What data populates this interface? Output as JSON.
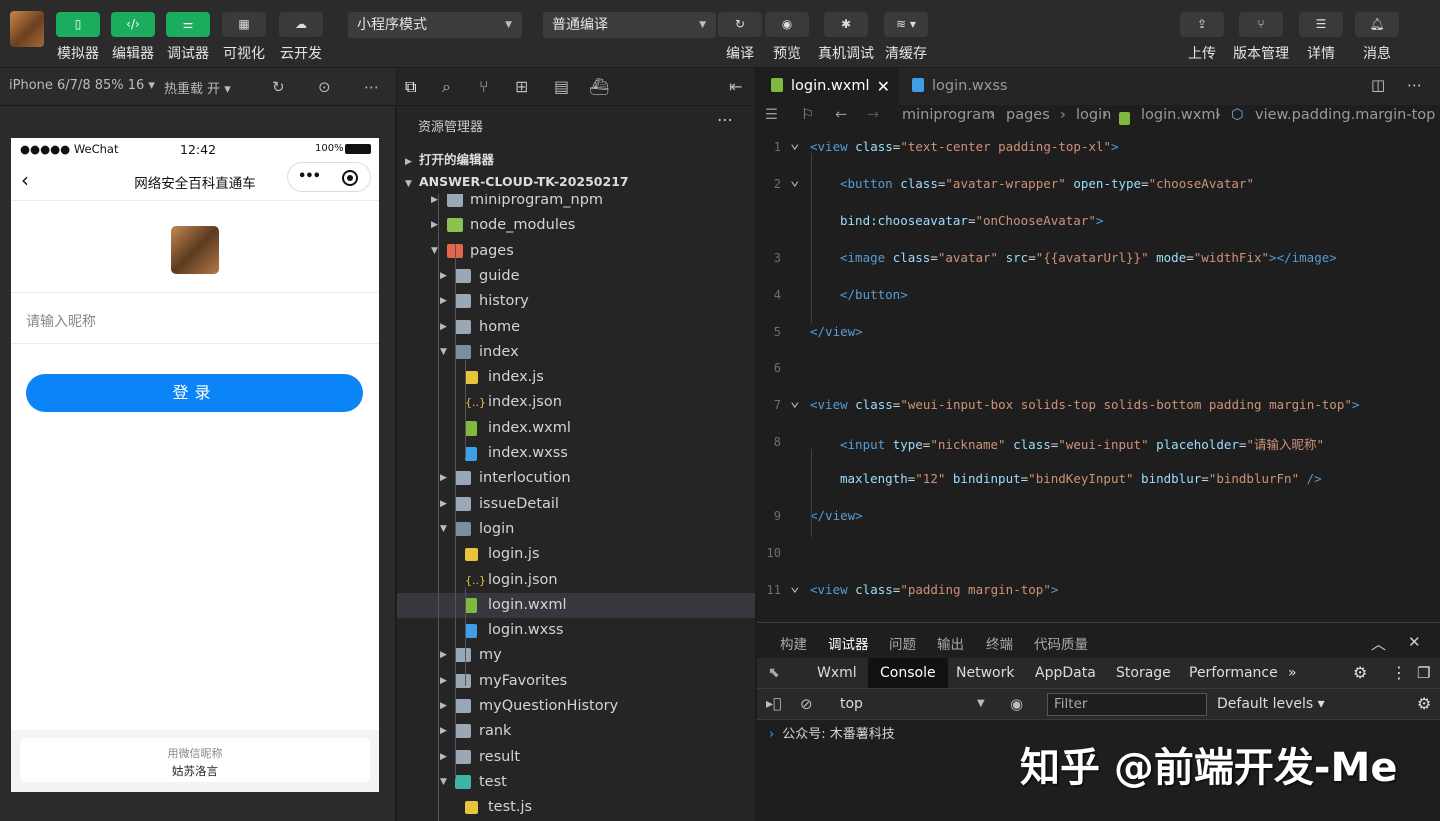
{
  "toolbar": {
    "left_buttons": [
      "模拟器",
      "编辑器",
      "调试器",
      "可视化",
      "云开发"
    ],
    "mode_select": "小程序模式",
    "compile_select": "普通编译",
    "mid_buttons": [
      "编译",
      "预览",
      "真机调试",
      "清缓存"
    ],
    "right_buttons": [
      "上传",
      "版本管理",
      "详情",
      "消息"
    ]
  },
  "sim_bar": {
    "device": "iPhone 6/7/8 85% 16 ▾",
    "hot_reload": "热重载 开 ▾"
  },
  "phone": {
    "carrier": "●●●●● WeChat",
    "time": "12:42",
    "battery": "100%",
    "nav_title": "网络安全百科直通车",
    "nickname_placeholder": "请输入昵称",
    "login_button": "登录",
    "bottom_hint": "用微信昵称",
    "bottom_name": "姑苏洛言"
  },
  "explorer": {
    "title": "资源管理器",
    "open_editors": "打开的编辑器",
    "project": "ANSWER-CLOUD-TK-20250217",
    "tree": [
      {
        "name": "miniprogram_npm",
        "depth": 1,
        "type": "folder",
        "arrow": "▸"
      },
      {
        "name": "node_modules",
        "depth": 1,
        "type": "node",
        "arrow": "▸"
      },
      {
        "name": "pages",
        "depth": 1,
        "type": "pages",
        "arrow": "▾"
      },
      {
        "name": "guide",
        "depth": 2,
        "type": "folder",
        "arrow": "▸"
      },
      {
        "name": "history",
        "depth": 2,
        "type": "folder",
        "arrow": "▸"
      },
      {
        "name": "home",
        "depth": 2,
        "type": "folder",
        "arrow": "▸"
      },
      {
        "name": "index",
        "depth": 2,
        "type": "folder-open",
        "arrow": "▾"
      },
      {
        "name": "index.js",
        "depth": 3,
        "type": "js",
        "arrow": ""
      },
      {
        "name": "index.json",
        "depth": 3,
        "type": "json",
        "arrow": ""
      },
      {
        "name": "index.wxml",
        "depth": 3,
        "type": "wxml",
        "arrow": ""
      },
      {
        "name": "index.wxss",
        "depth": 3,
        "type": "wxss",
        "arrow": ""
      },
      {
        "name": "interlocution",
        "depth": 2,
        "type": "folder",
        "arrow": "▸"
      },
      {
        "name": "issueDetail",
        "depth": 2,
        "type": "folder",
        "arrow": "▸"
      },
      {
        "name": "login",
        "depth": 2,
        "type": "folder-open",
        "arrow": "▾"
      },
      {
        "name": "login.js",
        "depth": 3,
        "type": "js",
        "arrow": ""
      },
      {
        "name": "login.json",
        "depth": 3,
        "type": "json",
        "arrow": ""
      },
      {
        "name": "login.wxml",
        "depth": 3,
        "type": "wxml",
        "arrow": "",
        "selected": true
      },
      {
        "name": "login.wxss",
        "depth": 3,
        "type": "wxss",
        "arrow": ""
      },
      {
        "name": "my",
        "depth": 2,
        "type": "folder",
        "arrow": "▸"
      },
      {
        "name": "myFavorites",
        "depth": 2,
        "type": "folder",
        "arrow": "▸"
      },
      {
        "name": "myQuestionHistory",
        "depth": 2,
        "type": "folder",
        "arrow": "▸"
      },
      {
        "name": "rank",
        "depth": 2,
        "type": "folder",
        "arrow": "▸"
      },
      {
        "name": "result",
        "depth": 2,
        "type": "folder",
        "arrow": "▸"
      },
      {
        "name": "test",
        "depth": 2,
        "type": "test",
        "arrow": "▾"
      },
      {
        "name": "test.js",
        "depth": 3,
        "type": "js",
        "arrow": ""
      }
    ]
  },
  "editor": {
    "tabs": [
      "login.wxml",
      "login.wxss"
    ],
    "breadcrumb": [
      "miniprogram",
      "pages",
      "login",
      "login.wxml",
      "view.padding.margin-top"
    ],
    "code": [
      {
        "num": "1",
        "fold": true,
        "indent": 0,
        "tokens": [
          [
            "tg",
            "<view "
          ],
          [
            "at",
            "class"
          ],
          [
            "pl",
            "="
          ],
          [
            "st",
            "\"text-center padding-top-xl\""
          ],
          [
            "tg",
            ">"
          ]
        ]
      },
      {
        "num": "2",
        "fold": true,
        "indent": 1,
        "tokens": [
          [
            "tg",
            "<button "
          ],
          [
            "at",
            "class"
          ],
          [
            "pl",
            "="
          ],
          [
            "st",
            "\"avatar-wrapper\""
          ],
          [
            "at",
            " open-type"
          ],
          [
            "pl",
            "="
          ],
          [
            "st",
            "\"chooseAvatar\""
          ]
        ]
      },
      {
        "num": "",
        "fold": false,
        "indent": 1,
        "tokens": [
          [
            "at",
            "bind:chooseavatar"
          ],
          [
            "pl",
            "="
          ],
          [
            "st",
            "\"onChooseAvatar\""
          ],
          [
            "tg",
            ">"
          ]
        ]
      },
      {
        "num": "3",
        "fold": false,
        "indent": 1,
        "tokens": [
          [
            "tg",
            "<image "
          ],
          [
            "at",
            "class"
          ],
          [
            "pl",
            "="
          ],
          [
            "st",
            "\"avatar\""
          ],
          [
            "at",
            " src"
          ],
          [
            "pl",
            "="
          ],
          [
            "st",
            "\"{{avatarUrl}}\""
          ],
          [
            "at",
            " mode"
          ],
          [
            "pl",
            "="
          ],
          [
            "st",
            "\"widthFix\""
          ],
          [
            "tg",
            "></image>"
          ]
        ]
      },
      {
        "num": "4",
        "fold": false,
        "indent": 1,
        "tokens": [
          [
            "tg",
            "</button>"
          ]
        ]
      },
      {
        "num": "5",
        "fold": false,
        "indent": 0,
        "tokens": [
          [
            "tg",
            "</view>"
          ]
        ]
      },
      {
        "num": "6",
        "fold": false,
        "indent": 0,
        "tokens": []
      },
      {
        "num": "7",
        "fold": true,
        "indent": 0,
        "tokens": [
          [
            "tg",
            "<view "
          ],
          [
            "at",
            "class"
          ],
          [
            "pl",
            "="
          ],
          [
            "st",
            "\"weui-input-box solids-top solids-bottom padding margin-top\""
          ],
          [
            "tg",
            ">"
          ]
        ]
      },
      {
        "num": "8",
        "fold": false,
        "indent": 1,
        "tokens": [
          [
            "tg",
            "<input "
          ],
          [
            "at",
            "type"
          ],
          [
            "pl",
            "="
          ],
          [
            "st",
            "\"nickname\""
          ],
          [
            "at",
            " class"
          ],
          [
            "pl",
            "="
          ],
          [
            "st",
            "\"weui-input\""
          ],
          [
            "at",
            " placeholder"
          ],
          [
            "pl",
            "="
          ],
          [
            "st",
            "\"请输入昵称\""
          ]
        ]
      },
      {
        "num": "",
        "fold": false,
        "indent": 1,
        "tokens": [
          [
            "at",
            "maxlength"
          ],
          [
            "pl",
            "="
          ],
          [
            "st",
            "\"12\""
          ],
          [
            "at",
            " bindinput"
          ],
          [
            "pl",
            "="
          ],
          [
            "st",
            "\"bindKeyInput\""
          ],
          [
            "at",
            " bindblur"
          ],
          [
            "pl",
            "="
          ],
          [
            "st",
            "\"bindblurFn\""
          ],
          [
            "tg",
            " />"
          ]
        ]
      },
      {
        "num": "9",
        "fold": false,
        "indent": 0,
        "tokens": [
          [
            "tg",
            "</view>"
          ]
        ]
      },
      {
        "num": "10",
        "fold": false,
        "indent": 0,
        "tokens": []
      },
      {
        "num": "11",
        "fold": true,
        "indent": 0,
        "tokens": [
          [
            "tg",
            "<view "
          ],
          [
            "at",
            "class"
          ],
          [
            "pl",
            "="
          ],
          [
            "st",
            "\"padding margin-top\""
          ],
          [
            "tg",
            ">"
          ]
        ]
      }
    ]
  },
  "devtools": {
    "top_tabs": [
      "构建",
      "调试器",
      "问题",
      "输出",
      "终端",
      "代码质量"
    ],
    "sub_tabs": [
      "Wxml",
      "Console",
      "Network",
      "AppData",
      "Storage",
      "Performance"
    ],
    "context": "top",
    "filter_placeholder": "Filter",
    "levels": "Default levels ▾",
    "console_line": "公众号: 木番薯科技"
  },
  "watermark": "知乎 @前端开发-Me"
}
